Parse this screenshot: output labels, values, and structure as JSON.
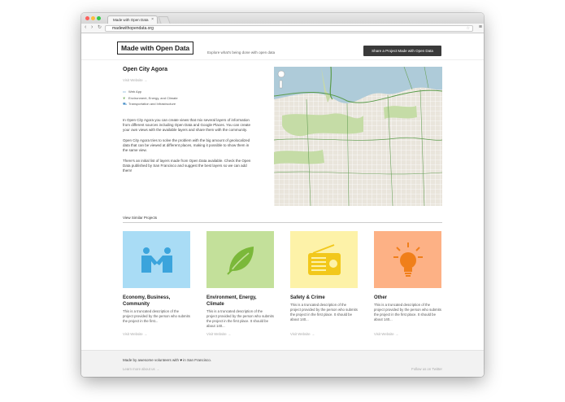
{
  "browser": {
    "tab_title": "Made with Open Data",
    "tab_close": "×",
    "url": "madewithopendata.org",
    "back_icon": "‹",
    "forward_icon": "›",
    "reload_icon": "↻",
    "star_icon": "☆",
    "menu_icon": "≡",
    "dot_colors": [
      "#fc605c",
      "#fdbc40",
      "#34c84a"
    ]
  },
  "header": {
    "logo": "Made with Open Data",
    "tagline": "Explore what's being done with open data",
    "cta": "Share a Project Made with Open Data"
  },
  "project": {
    "title": "Open City Agora",
    "visit": "Visit Website →",
    "tags": [
      {
        "icon": "web-icon",
        "glyph": "▭",
        "label": "Web App"
      },
      {
        "icon": "leaf-icon",
        "glyph": "❦",
        "label": "Environment, Energy, and Climate"
      },
      {
        "icon": "transport-icon",
        "glyph": "⛟",
        "label": "Transportation and Infrastructure"
      }
    ],
    "paragraphs": [
      "In Open City Agora you can create views that mix several layers of information from different sources including Open Data and Google Places. You can create your own views with the available layers and share them with the community.",
      "Open City Agora tries to solve the problem with the big amount of geolocalized data that can be viewed at different places, making it possible to show them in the same view.",
      "There's an initial list of layers made from Open Data available. Check the Open Data published by San Francisco and suggest the best layers so we can add them!"
    ]
  },
  "similar": {
    "heading": "View Similar Projects",
    "cards": [
      {
        "title": "Economy, Business, Community",
        "desc": "This is a truncated description of the project provided by the person who submits the project in the first...",
        "visit": "Visit Website →",
        "color": "#a9dcf5",
        "icon": "handshake-icon"
      },
      {
        "title": "Environment, Energy, Climate",
        "desc": "This is a truncated description of the project provided by the person who submits the project in the first place. It should be about 140...",
        "visit": "Visit Website →",
        "color": "#c3e09a",
        "icon": "leaf-icon"
      },
      {
        "title": "Safety & Crime",
        "desc": "This is a truncated description of the project provided by the person who submits the project in the first place. It should be about 140...",
        "visit": "Visit Website →",
        "color": "#fdf2a8",
        "icon": "radio-icon"
      },
      {
        "title": "Other",
        "desc": "This is a truncated description of the project provided by the person who submits the project in the first place. It should be about 140...",
        "visit": "Visit Website →",
        "color": "#fdb185",
        "icon": "lightbulb-icon"
      }
    ]
  },
  "footer": {
    "made_prefix": "Made by awesome volunteers with",
    "heart": "♥",
    "made_suffix": "in San Francisco.",
    "learn": "Learn more about us →",
    "twitter": "Follow us on Twitter"
  }
}
